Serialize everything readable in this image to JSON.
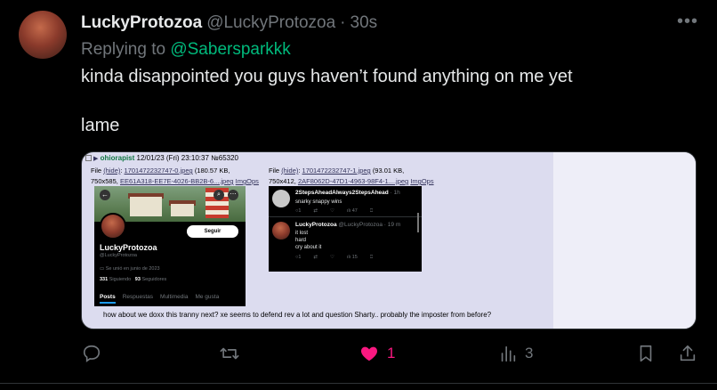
{
  "tweet": {
    "display_name": "LuckyProtozoa",
    "handle": "@LuckyProtozoa",
    "separator": "·",
    "time": "30s",
    "reply_prefix": "Replying to",
    "reply_mention": "@Sabersparkkk",
    "text_line1": "kinda disappointed you guys haven’t found anything on me yet",
    "text_line2": "lame",
    "more_label": "•••"
  },
  "media": {
    "post_header": {
      "name": "ohiorapist",
      "date": "12/01/23 (Fri) 23:10:37",
      "post_no": "№65320"
    },
    "file1": {
      "label": "File",
      "hide": "(hide)",
      "filename": "1701472232747-0.jpeg",
      "size": "(180.57 KB,",
      "dims": "750x585,",
      "link": "EE61A318-EE7E-4026-BB2B-6....jpeg",
      "img_ops": "ImgOps"
    },
    "file2": {
      "label": "File",
      "hide": "(hide)",
      "filename": "1701472232747-1.jpeg",
      "size": "(93.01 KB,",
      "dims": "750x412,",
      "link": "2AF8062D-47D1-4963-98F4-1....jpeg",
      "img_ops": "ImgOps"
    },
    "shot1": {
      "follow_label": "Seguir",
      "name": "LuckyProtozoa",
      "handle": "@LuckyProtozoa",
      "joined": "Se unió en junio de 2023",
      "following_count": "331",
      "following_label": "Siguiendo",
      "followers_count": "93",
      "followers_label": "Seguidores",
      "tabs": [
        "Posts",
        "Respuestas",
        "Multimedia",
        "Me gusta"
      ]
    },
    "shot2": {
      "tweet1_name": "2StepsAheadAlways2StepsAhead",
      "tweet1_time": "· 1h",
      "tweet1_text": "snarky snappy wins",
      "tweet1_likes": "47",
      "tweet2_name": "LuckyProtozoa",
      "tweet2_handle": "@LuckyProtozoa · 19 m",
      "tweet2_lines": [
        "it lost",
        "hard",
        "cry about it"
      ],
      "tweet2_views": "15"
    },
    "comment": "how about we doxx this tranny next? xe seems to defend rev a lot and question Sharty.. probably the imposter from before?"
  },
  "actions": {
    "reply_count": "",
    "retweet_count": "",
    "like_count": "1",
    "views_count": "3"
  },
  "colors": {
    "background": "#000000",
    "text": "#e7e9ea",
    "muted": "#71767b",
    "like": "#f91880",
    "mention": "#00ba7c",
    "media_bg": "#dcdcef"
  }
}
